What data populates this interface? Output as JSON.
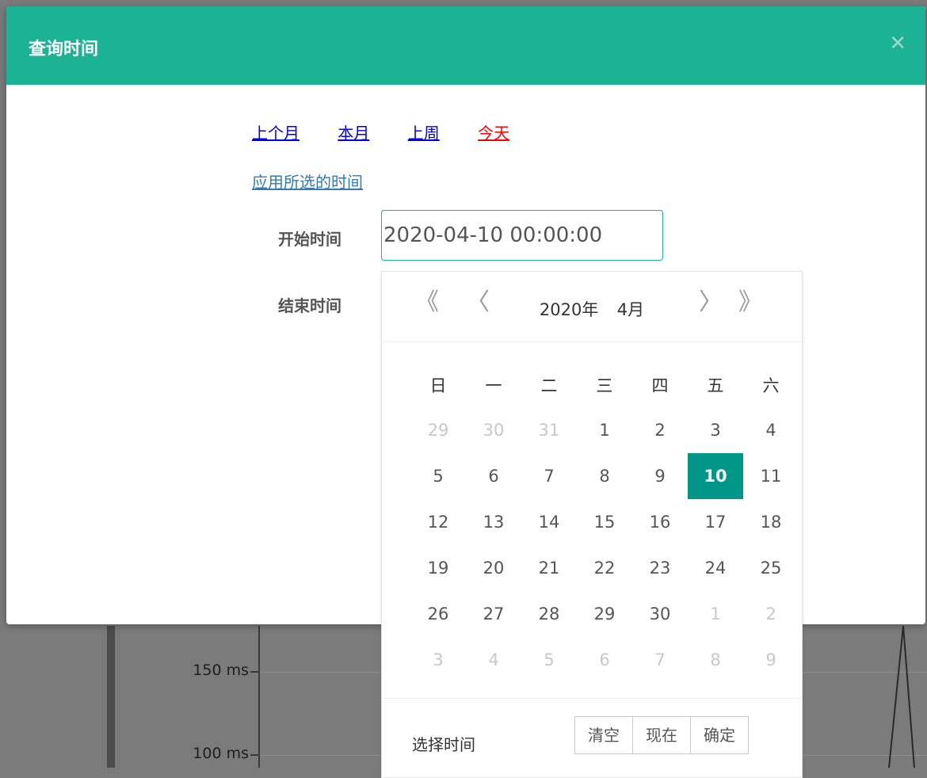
{
  "modal": {
    "title": "查询时间",
    "close_icon": "close-icon",
    "header_color": "#1bb394"
  },
  "quick_links": {
    "last_month": "上个月",
    "this_month": "本月",
    "last_week": "上周",
    "today": "今天",
    "apply": "应用所选的时间"
  },
  "form": {
    "start_label": "开始时间",
    "start_value": "2020-04-10 00:00:00",
    "end_label": "结束时间"
  },
  "picker": {
    "prev_year_icon": "double-chevron-left-icon",
    "prev_month_icon": "chevron-left-icon",
    "next_month_icon": "chevron-right-icon",
    "next_year_icon": "double-chevron-right-icon",
    "year_label": "2020年",
    "month_label": "4月",
    "weekdays": [
      "日",
      "一",
      "二",
      "三",
      "四",
      "五",
      "六"
    ],
    "weeks": [
      [
        {
          "d": "29",
          "o": true
        },
        {
          "d": "30",
          "o": true
        },
        {
          "d": "31",
          "o": true
        },
        {
          "d": "1"
        },
        {
          "d": "2"
        },
        {
          "d": "3"
        },
        {
          "d": "4"
        }
      ],
      [
        {
          "d": "5"
        },
        {
          "d": "6"
        },
        {
          "d": "7"
        },
        {
          "d": "8"
        },
        {
          "d": "9"
        },
        {
          "d": "10",
          "s": true
        },
        {
          "d": "11"
        }
      ],
      [
        {
          "d": "12"
        },
        {
          "d": "13"
        },
        {
          "d": "14"
        },
        {
          "d": "15"
        },
        {
          "d": "16"
        },
        {
          "d": "17"
        },
        {
          "d": "18"
        }
      ],
      [
        {
          "d": "19"
        },
        {
          "d": "20"
        },
        {
          "d": "21"
        },
        {
          "d": "22"
        },
        {
          "d": "23"
        },
        {
          "d": "24"
        },
        {
          "d": "25"
        }
      ],
      [
        {
          "d": "26"
        },
        {
          "d": "27"
        },
        {
          "d": "28"
        },
        {
          "d": "29"
        },
        {
          "d": "30"
        },
        {
          "d": "1",
          "o": true
        },
        {
          "d": "2",
          "o": true
        }
      ],
      [
        {
          "d": "3",
          "o": true
        },
        {
          "d": "4",
          "o": true
        },
        {
          "d": "5",
          "o": true
        },
        {
          "d": "6",
          "o": true
        },
        {
          "d": "7",
          "o": true
        },
        {
          "d": "8",
          "o": true
        },
        {
          "d": "9",
          "o": true
        }
      ]
    ],
    "selected_color": "#009688",
    "select_time": "选择时间",
    "clear": "清空",
    "now": "现在",
    "confirm": "确定"
  },
  "background": {
    "label_150": "150 ms",
    "label_100": "100 ms"
  }
}
